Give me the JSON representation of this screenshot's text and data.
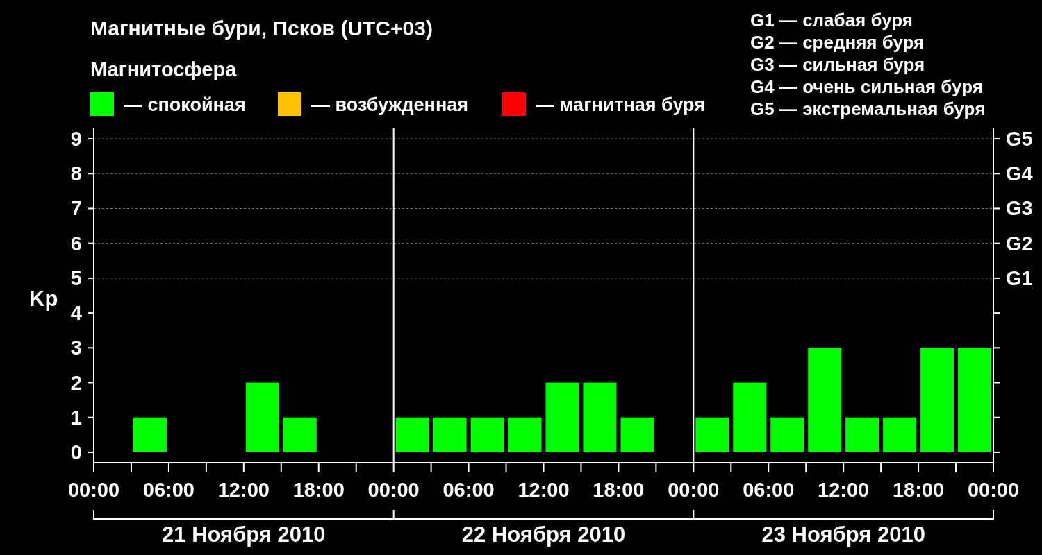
{
  "title": "Магнитные бури, Псков (UTC+03)",
  "legend": {
    "heading": "Магнитосфера",
    "items": [
      {
        "label": "— спокойная",
        "color": "#00ff00"
      },
      {
        "label": "— возбужденная",
        "color": "#ffc000"
      },
      {
        "label": "— магнитная буря",
        "color": "#ff0000"
      }
    ]
  },
  "scale": [
    "G1 — слабая буря",
    "G2 — средняя буря",
    "G3 — сильная буря",
    "G4 — очень сильная буря",
    "G5 — экстремальная буря"
  ],
  "chart": {
    "chart_data": {
      "type": "bar",
      "ylabel": "Kp",
      "series": [
        {
          "color": "#00ff00",
          "values": [
            0,
            1,
            0,
            0,
            2,
            1,
            0,
            0,
            1,
            1,
            1,
            1,
            2,
            2,
            1,
            0,
            1,
            2,
            1,
            3,
            1,
            1,
            3,
            3
          ]
        }
      ],
      "ylim": [
        -0.3,
        9.3
      ],
      "yticks": [
        0,
        1,
        2,
        3,
        4,
        5,
        6,
        7,
        8,
        9
      ],
      "grid": true
    },
    "storm_levels": [
      "G5",
      "G4",
      "G3",
      "G2",
      "G1"
    ],
    "time_labels": [
      "00:00",
      "06:00",
      "12:00",
      "18:00",
      "00:00",
      "06:00",
      "12:00",
      "18:00",
      "00:00",
      "06:00",
      "12:00",
      "18:00",
      "00:00"
    ],
    "days": [
      "21 Ноября 2010",
      "22 Ноября 2010",
      "23 Ноября 2010"
    ]
  }
}
